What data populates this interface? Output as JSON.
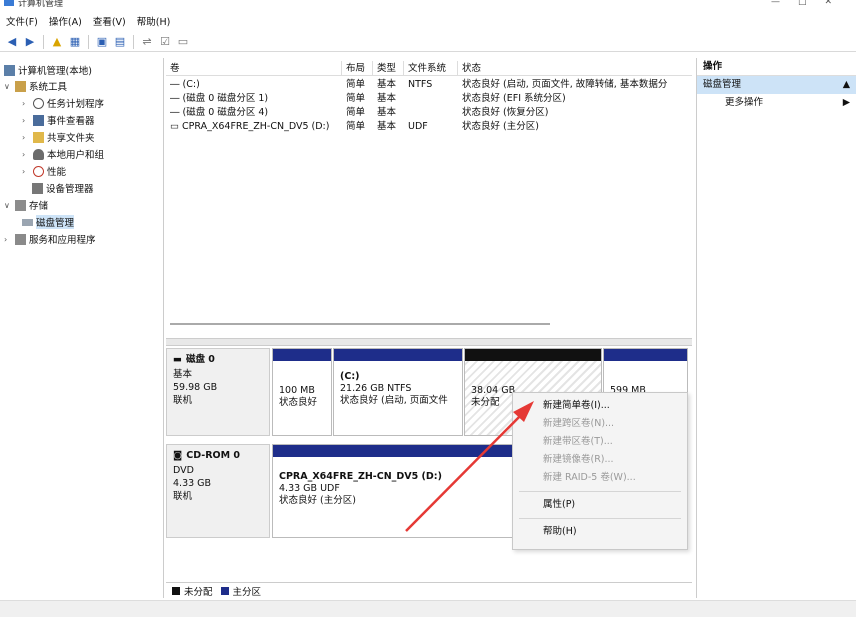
{
  "window": {
    "title": "计算机管理"
  },
  "menu": [
    "文件(F)",
    "操作(A)",
    "查看(V)",
    "帮助(H)"
  ],
  "tree": {
    "root": "计算机管理(本地)",
    "system_tools": "系统工具",
    "task_scheduler": "任务计划程序",
    "event_viewer": "事件查看器",
    "shared_folders": "共享文件夹",
    "local_users": "本地用户和组",
    "performance": "性能",
    "device_manager": "设备管理器",
    "storage": "存储",
    "disk_management": "磁盘管理",
    "services": "服务和应用程序"
  },
  "volumes": {
    "headers": [
      "卷",
      "布局",
      "类型",
      "文件系统",
      "状态"
    ],
    "rows": [
      [
        "(C:)",
        "简单",
        "基本",
        "NTFS",
        "状态良好 (启动, 页面文件, 故障转储, 基本数据分"
      ],
      [
        "(磁盘 0 磁盘分区 1)",
        "简单",
        "基本",
        "",
        "状态良好 (EFI 系统分区)"
      ],
      [
        "(磁盘 0 磁盘分区 4)",
        "简单",
        "基本",
        "",
        "状态良好 (恢复分区)"
      ],
      [
        "CPRA_X64FRE_ZH-CN_DV5 (D:)",
        "简单",
        "基本",
        "UDF",
        "状态良好 (主分区)"
      ]
    ]
  },
  "disk0": {
    "name": "磁盘 0",
    "type": "基本",
    "size": "59.98 GB",
    "status": "联机",
    "p1": {
      "size": "100 MB",
      "status": "状态良好"
    },
    "p2": {
      "name": "(C:)",
      "size": "21.26 GB NTFS",
      "status": "状态良好 (启动, 页面文件"
    },
    "p3": {
      "size": "38.04 GB",
      "status": "未分配"
    },
    "p4": {
      "size": "599 MB"
    }
  },
  "cdrom": {
    "name": "CD-ROM 0",
    "type": "DVD",
    "size": "4.33 GB",
    "status": "联机",
    "part": {
      "name": "CPRA_X64FRE_ZH-CN_DV5 (D:)",
      "size": "4.33 GB UDF",
      "status": "状态良好 (主分区)"
    }
  },
  "legend": {
    "unallocated": "未分配",
    "primary": "主分区"
  },
  "actions": {
    "header": "操作",
    "section": "磁盘管理",
    "more": "更多操作"
  },
  "context_menu": {
    "new_simple": "新建简单卷(I)...",
    "new_spanned": "新建跨区卷(N)...",
    "new_striped": "新建带区卷(T)...",
    "new_mirror": "新建镜像卷(R)...",
    "new_raid5": "新建 RAID-5 卷(W)...",
    "properties": "属性(P)",
    "help": "帮助(H)"
  },
  "colors": {
    "primary_partition": "#1e2d8a",
    "unallocated": "#111111",
    "selection": "#cde3f7",
    "arrow": "#e53935"
  }
}
